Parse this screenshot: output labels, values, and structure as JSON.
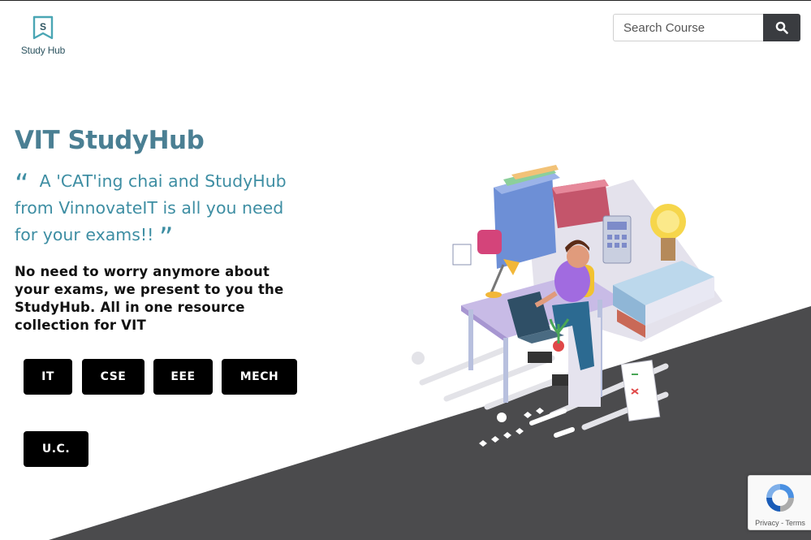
{
  "logo": {
    "icon": "bookmark-s-icon",
    "letter": "S",
    "text": "Study Hub"
  },
  "search": {
    "placeholder": "Search Course",
    "button_icon": "search-icon"
  },
  "hero": {
    "title": "VIT StudyHub",
    "quote_open": "“",
    "quote_close": "”",
    "quote": "A 'CAT'ing chai and StudyHub from VinnovateIT is all you need for your exams!!",
    "description": "No need to worry anymore about your exams, we present to you the StudyHub. All in one resource collection for VIT"
  },
  "branches": [
    {
      "label": "IT"
    },
    {
      "label": "CSE"
    },
    {
      "label": "EEE"
    },
    {
      "label": "MECH"
    },
    {
      "label": "U.C."
    }
  ],
  "recaptcha": {
    "privacy": "Privacy",
    "separator": " - ",
    "terms": "Terms"
  },
  "colors": {
    "title": "#4a7f93",
    "quote": "#3e8ea3",
    "button_bg": "#000000",
    "diagonal_band": "#4b4b4d",
    "search_button": "#3a3c40"
  }
}
